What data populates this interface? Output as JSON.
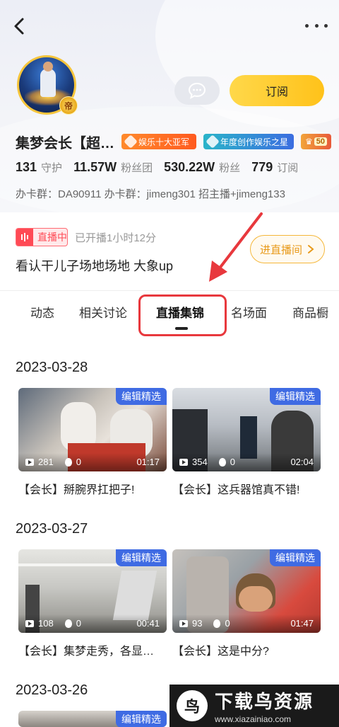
{
  "header": {
    "back_icon": "chevron-left-icon",
    "more_icon": "more-horizontal-icon"
  },
  "profile": {
    "avatar_badge": "帝",
    "subscribe_label": "订阅",
    "chat_icon": "chat-bubble-icon",
    "name": "集梦会长【超…",
    "medals": [
      {
        "label": "娱乐十大亚军"
      },
      {
        "label": "年度创作娱乐之星"
      },
      {
        "label": "50"
      }
    ],
    "stats": [
      {
        "value": "131",
        "label": "守护"
      },
      {
        "value": "11.57W",
        "label": "粉丝团"
      },
      {
        "value": "530.22W",
        "label": "粉丝"
      },
      {
        "value": "779",
        "label": "订阅"
      }
    ],
    "description": "办卡群：DA90911 办卡群：jimeng301  招主播+jimeng133"
  },
  "live": {
    "badge": "直播中",
    "elapsed": "已开播1小时12分",
    "title": "看认干儿子场地场地 大象up",
    "enter_label": "进直播间"
  },
  "tabs": [
    {
      "label": "动态"
    },
    {
      "label": "相关讨论"
    },
    {
      "label": "直播集锦",
      "active": true
    },
    {
      "label": "名场面"
    },
    {
      "label": "商品橱"
    }
  ],
  "sections": [
    {
      "date": "2023-03-28",
      "cards": [
        {
          "tag": "编辑精选",
          "plays": "281",
          "likes": "0",
          "duration": "01:17",
          "title": "【会长】掰腕界扛把子!"
        },
        {
          "tag": "编辑精选",
          "plays": "354",
          "likes": "0",
          "duration": "02:04",
          "title": "【会长】这兵器馆真不错!"
        }
      ]
    },
    {
      "date": "2023-03-27",
      "cards": [
        {
          "tag": "编辑精选",
          "plays": "108",
          "likes": "0",
          "duration": "00:41",
          "title": "【会长】集梦走秀，各显…"
        },
        {
          "tag": "编辑精选",
          "plays": "93",
          "likes": "0",
          "duration": "01:47",
          "title": "【会长】这是中分?"
        }
      ]
    },
    {
      "date": "2023-03-26",
      "cards": [
        {
          "tag": "编辑精选"
        }
      ]
    }
  ],
  "watermark": {
    "title": "下载鸟资源",
    "url": "www.xiazainiao.com"
  },
  "colors": {
    "accent_yellow": "#ffc21a",
    "live_red": "#ff4a55",
    "tag_blue": "#3f6be3",
    "highlight_red": "#e8383d"
  }
}
